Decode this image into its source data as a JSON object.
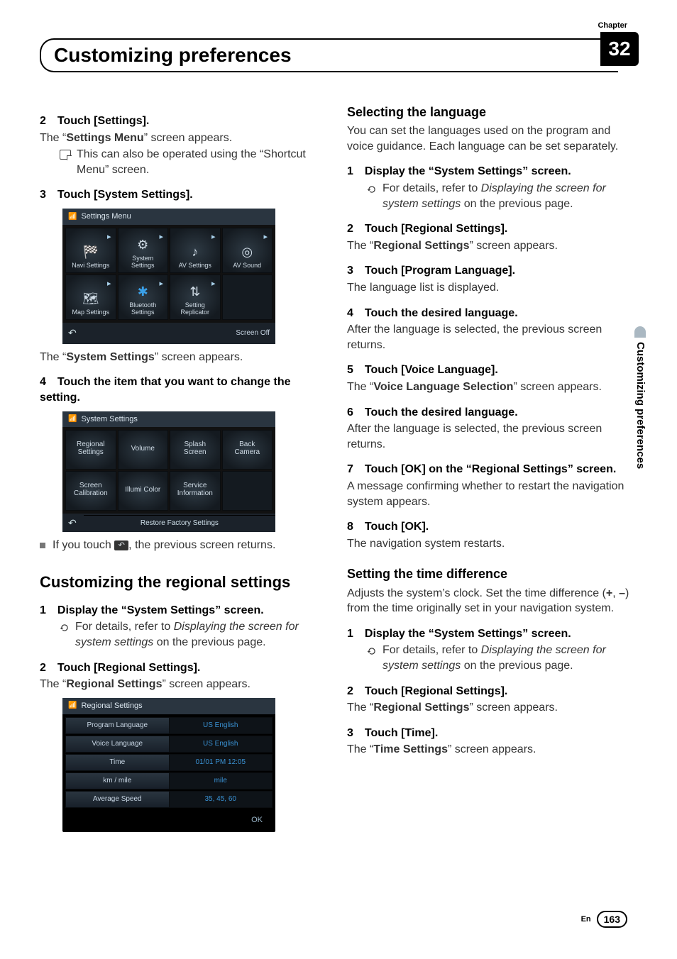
{
  "chapter": {
    "label": "Chapter",
    "number": "32"
  },
  "page_title": "Customizing preferences",
  "sidebar_label": "Customizing preferences",
  "footer": {
    "lang": "En",
    "page": "163"
  },
  "left": {
    "s2": {
      "head": "2 Touch [Settings].",
      "line1a": "The “",
      "line1b": "Settings Menu",
      "line1c": "” screen appears.",
      "note": "This can also be operated using the “Shortcut Menu” screen."
    },
    "s3": {
      "head": "3 Touch [System Settings]."
    },
    "shot1": {
      "title": "Settings Menu",
      "cells": [
        "Navi Settings",
        "System\nSettings",
        "AV Settings",
        "AV Sound",
        "Map Settings",
        "Bluetooth\nSettings",
        "Setting\nReplicator"
      ],
      "screen_off": "Screen Off"
    },
    "after1a": "The “",
    "after1b": "System Settings",
    "after1c": "” screen appears.",
    "s4": {
      "head": "4 Touch the item that you want to change the setting."
    },
    "shot2": {
      "title": "System Settings",
      "cells": [
        "Regional\nSettings",
        "Volume",
        "Splash\nScreen",
        "Back\nCamera",
        "Screen\nCalibration",
        "Illumi Color",
        "Service\nInformation"
      ],
      "restore": "Restore Factory Settings"
    },
    "backnote_a": "If you touch ",
    "backnote_b": ", the previous screen returns.",
    "regional_h2": "Customizing the regional settings",
    "r1": {
      "head": "1 Display the “System Settings” screen.",
      "ref1": "For details, refer to ",
      "ref2": "Displaying the screen for system settings",
      "ref3": " on the previous page."
    },
    "r2": {
      "head": "2 Touch [Regional Settings].",
      "line_a": "The “",
      "line_b": "Regional Settings",
      "line_c": "” screen appears."
    },
    "shot3": {
      "title": "Regional Settings",
      "rows": [
        {
          "l": "Program Language",
          "r": "US English"
        },
        {
          "l": "Voice Language",
          "r": "US English"
        },
        {
          "l": "Time",
          "r": "01/01 PM 12:05"
        },
        {
          "l": "km / mile",
          "r": "mile"
        },
        {
          "l": "Average Speed",
          "r": "35, 45, 60"
        }
      ],
      "ok": "OK"
    }
  },
  "right": {
    "lang_h3": "Selecting the language",
    "lang_intro": "You can set the languages used on the program and voice guidance. Each language can be set separately.",
    "l1": {
      "head": "1 Display the “System Settings” screen.",
      "ref1": "For details, refer to ",
      "ref2": "Displaying the screen for system settings",
      "ref3": " on the previous page."
    },
    "l2": {
      "head": "2 Touch [Regional Settings].",
      "a": "The “",
      "b": "Regional Settings",
      "c": "” screen appears."
    },
    "l3": {
      "head": "3 Touch [Program Language].",
      "line": "The language list is displayed."
    },
    "l4": {
      "head": "4 Touch the desired language.",
      "line": "After the language is selected, the previous screen returns."
    },
    "l5": {
      "head": "5 Touch [Voice Language].",
      "a": "The “",
      "b": "Voice Language Selection",
      "c": "” screen appears."
    },
    "l6": {
      "head": "6 Touch the desired language.",
      "line": "After the language is selected, the previous screen returns."
    },
    "l7": {
      "head": "7 Touch [OK] on the “Regional Settings” screen.",
      "line": "A message confirming whether to restart the navigation system appears."
    },
    "l8": {
      "head": "8 Touch [OK].",
      "line": "The navigation system restarts."
    },
    "time_h3": "Setting the time difference",
    "time_intro_a": "Adjusts the system’s clock. Set the time difference (",
    "time_intro_plus": "+",
    "time_intro_mid": ", ",
    "time_intro_minus": "–",
    "time_intro_b": ") from the time originally set in your navigation system.",
    "t1": {
      "head": "1 Display the “System Settings” screen.",
      "ref1": "For details, refer to ",
      "ref2": "Displaying the screen for system settings",
      "ref3": " on the previous page."
    },
    "t2": {
      "head": "2 Touch [Regional Settings].",
      "a": "The “",
      "b": "Regional Settings",
      "c": "” screen appears."
    },
    "t3": {
      "head": "3 Touch [Time].",
      "a": "The “",
      "b": "Time Settings",
      "c": "” screen appears."
    }
  }
}
